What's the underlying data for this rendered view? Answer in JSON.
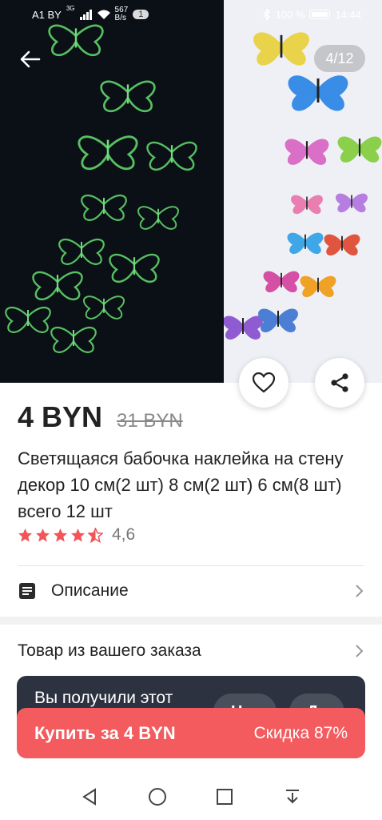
{
  "status_bar": {
    "carrier": "A1 BY",
    "network": "3G",
    "net_speed_value": "567",
    "net_speed_unit": "B/s",
    "notifications": "1",
    "battery": "100 %",
    "time": "14:44"
  },
  "gallery": {
    "counter": "4/12"
  },
  "product": {
    "price": "4 BYN",
    "old_price": "31 BYN",
    "title": "Светящаяся бабочка наклейка на стену декор 10 см(2 шт) 8 см(2 шт) 6 см(8 шт) всего 12 шт",
    "rating": "4,6",
    "rating_stars": 4.5
  },
  "sections": {
    "description_label": "Описание",
    "order_item_label": "Товар из вашего заказа"
  },
  "review_prompt": {
    "text": "Вы получили этот",
    "no_label": "Нет",
    "yes_label": "Да"
  },
  "buy": {
    "label": "Купить за 4 BYN",
    "discount": "Скидка 87%"
  },
  "colors": {
    "accent": "#f35b5e",
    "star": "#f25558",
    "card_dark": "#2d3240"
  },
  "icons": {
    "back": "arrow-left-icon",
    "favorite": "heart-icon",
    "share": "share-icon",
    "description": "document-icon",
    "chevron": "chevron-right-icon"
  }
}
